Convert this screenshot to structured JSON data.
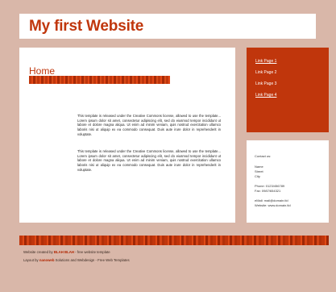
{
  "header": {
    "title": "My first Website"
  },
  "main": {
    "heading": "Home",
    "paragraphs": [
      "This template is released under the Creative Commons license, allowed to use the template... Lorem ipsum dolor sit amet, consectetur adipiscing elit, sed do eiusmod tempor incididunt ut labore et dolore magna aliqua. Ut enim ad minim veniam, quis nostrud exercitation ullamco laboris nisi ut aliquip ex ea commodo consequat. Duis aute irure dolor in reprehenderit in voluptate.",
      "This template is released under the Creative Commons license, allowed to use the template... Lorem ipsum dolor sit amet, consectetur adipiscing elit, sed do eiusmod tempor incididunt ut labore et dolore magna aliqua. Ut enim ad minim veniam, quis nostrud exercitation ullamco laboris nisi ut aliquip ex ea commodo consequat. Duis aute irure dolor in reprehenderit in voluptate."
    ]
  },
  "nav": {
    "items": [
      {
        "label": "Link Page 1"
      },
      {
        "label": "Link Page 2"
      },
      {
        "label": "Link Page 3"
      },
      {
        "label": "Link Page 4"
      }
    ]
  },
  "contact": {
    "lines": [
      "Contact us:",
      "Name",
      "Street",
      "City",
      "Phone: 0123/456789",
      "Fax: 0987/654321",
      "eMail: mail@domain.tld",
      "Website: www.domain.tld"
    ]
  },
  "footer": {
    "line1_pre": "Website created by ",
    "line1_hl": "BLAH BLAH",
    "line1_post": " - free website template",
    "line2_pre": "Layout by ",
    "line2_hl": "nanoweb",
    "line2_post": " Solutions and Webdesign - Free Web Templates"
  },
  "colors": {
    "accent": "#c0360c",
    "background": "#d9b7a9"
  }
}
